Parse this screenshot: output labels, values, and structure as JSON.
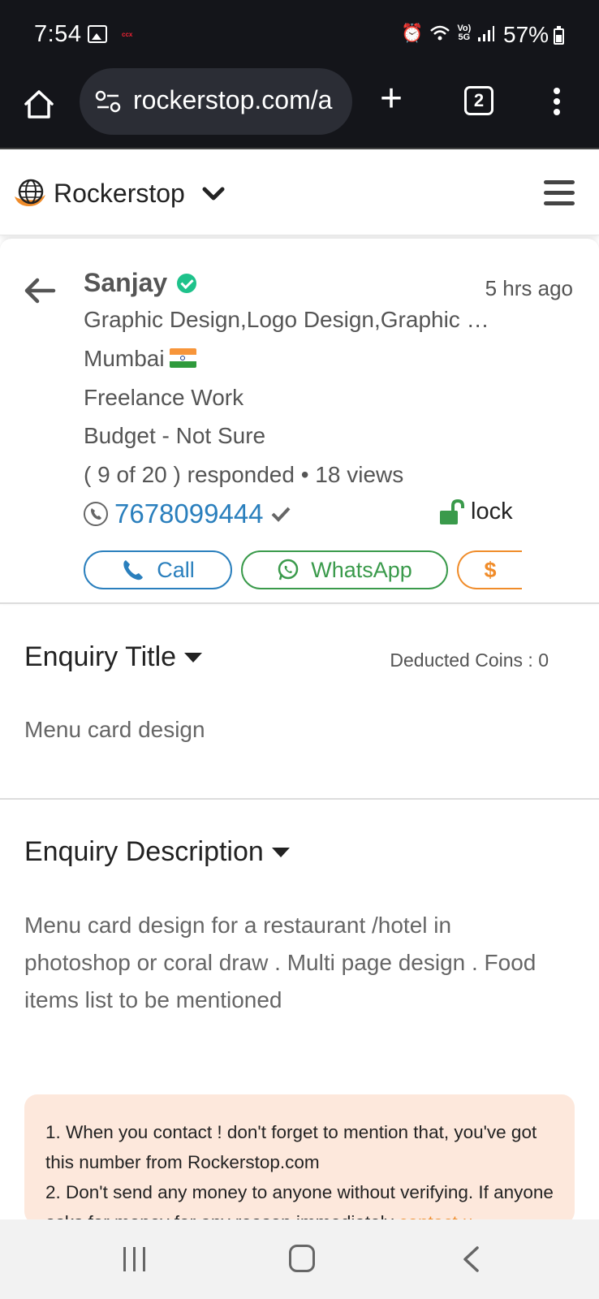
{
  "status_bar": {
    "time": "7:54",
    "notif_text": "ccx",
    "battery": "57%"
  },
  "browser": {
    "url": "rockerstop.com/a",
    "tab_count": "2"
  },
  "site": {
    "brand": "Rockerstop"
  },
  "enquiry_card": {
    "name": "Sanjay",
    "time_ago": "5 hrs ago",
    "categories": "Graphic Design,Logo Design,Graphic …",
    "location": "Mumbai",
    "work_type": "Freelance Work",
    "budget": "Budget - Not Sure",
    "stats": "( 9 of 20 ) responded • 18 views",
    "phone": "7678099444",
    "lock_label": "lock",
    "call_label": "Call",
    "whatsapp_label": "WhatsApp",
    "pay_label": "$"
  },
  "title_section": {
    "heading": "Enquiry Title",
    "coins": "Deducted Coins : 0",
    "body": "Menu card design"
  },
  "description_section": {
    "heading": "Enquiry Description",
    "body": "Menu card design for a restaurant /hotel in photoshop or coral draw . Multi page design . Food items list to be mentioned"
  },
  "notice": {
    "line1": "1. When you contact ! don't forget to mention that, you've got this number from Rockerstop.com",
    "line2": "2. Don't send any money to anyone without verifying. If anyone asks for money for any reason immediately ",
    "link": "contact u"
  },
  "colors": {
    "accent_blue": "#2a7fbd",
    "whatsapp_green": "#3a9a4b",
    "orange": "#f08c2a",
    "verified_green": "#1ec28b"
  }
}
